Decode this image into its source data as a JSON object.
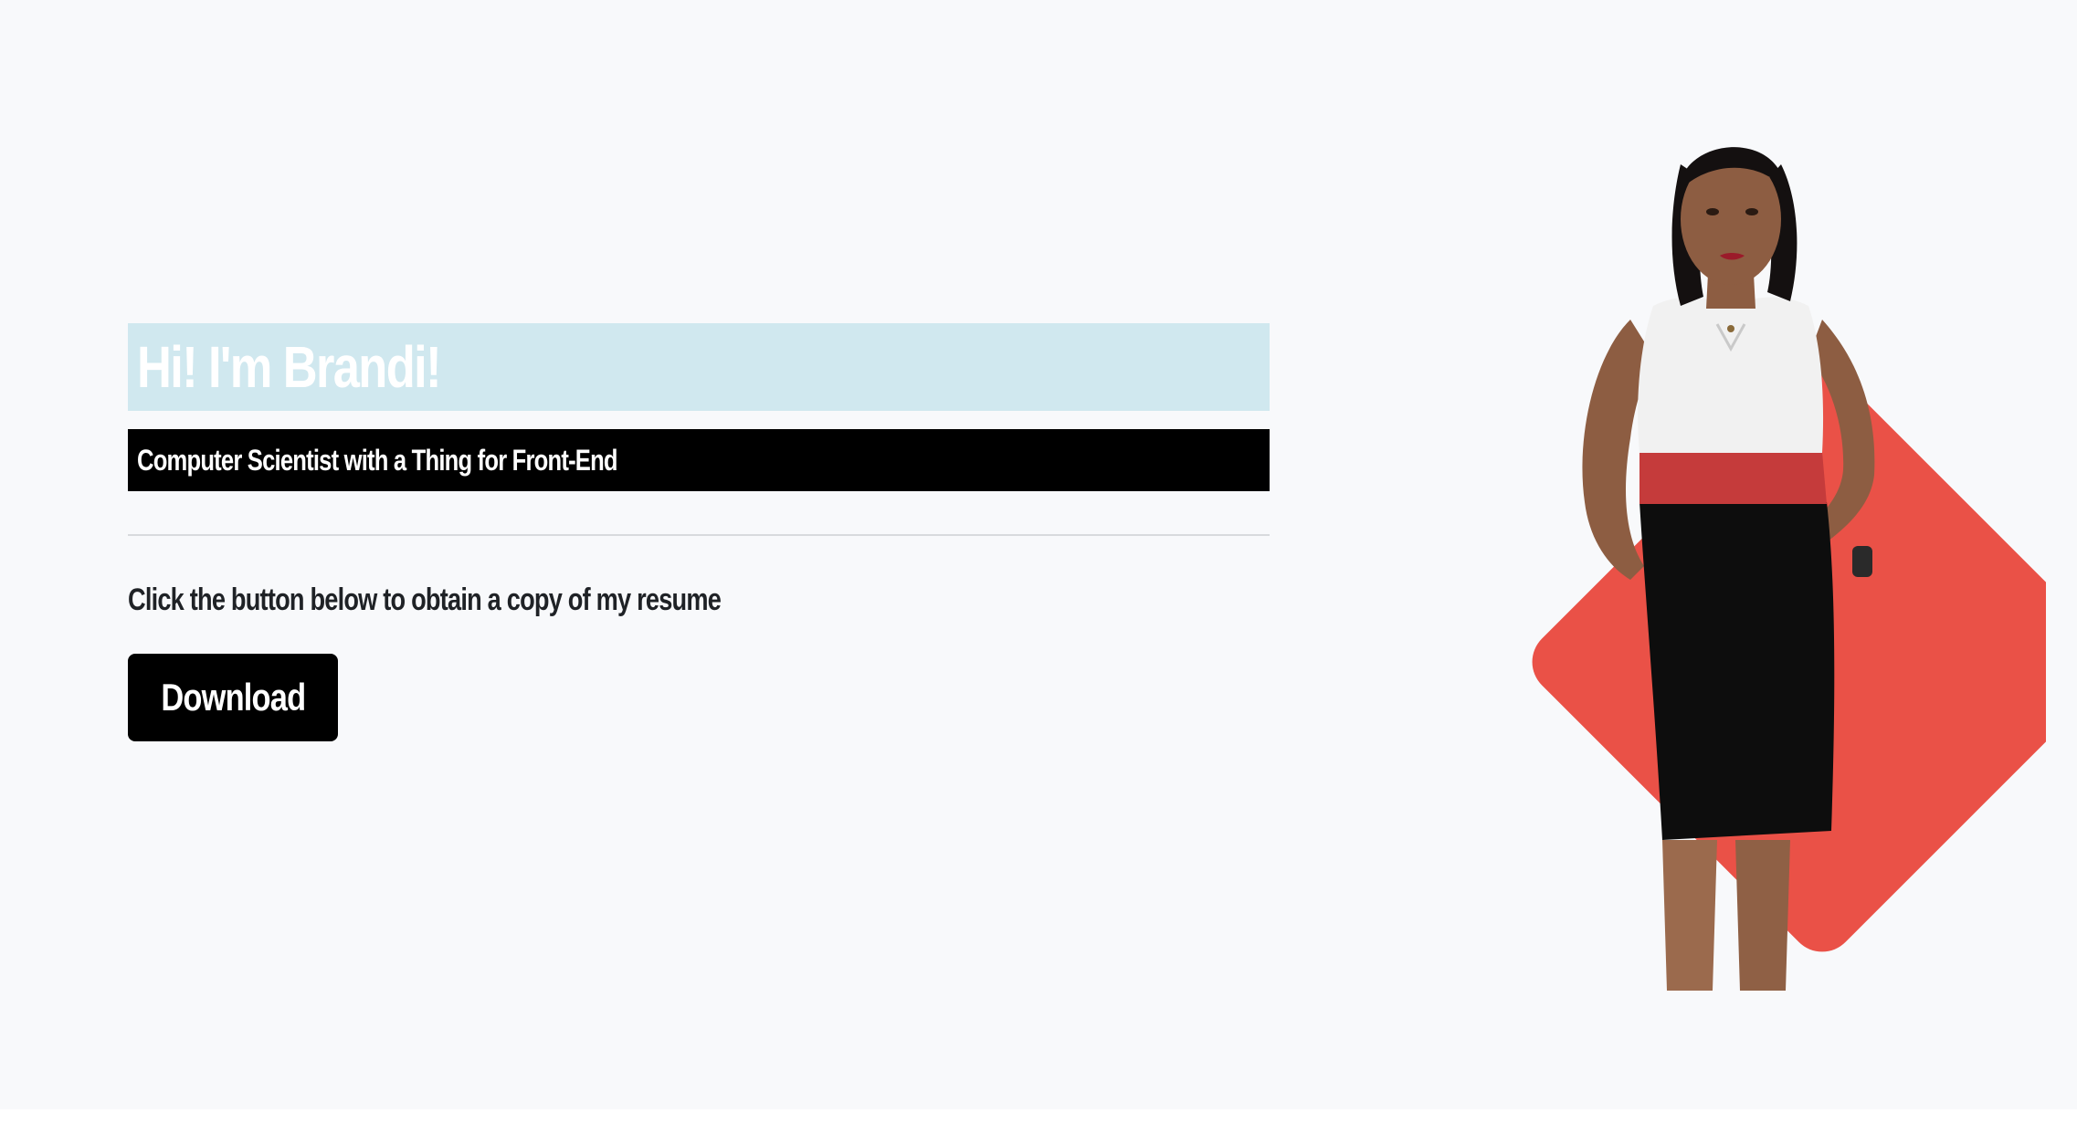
{
  "hero": {
    "heading": "Hi! I'm Brandi!",
    "subtitle": "Computer Scientist with a Thing for Front-End"
  },
  "resume": {
    "prompt": "Click the button below to obtain a copy of my resume",
    "download_label": "Download"
  },
  "portrait": {
    "alt": "Brandi"
  },
  "colors": {
    "heading_banner": "#d0e8ef",
    "subtitle_banner": "#000000",
    "button": "#000000",
    "accent_diamond": "#ea5147",
    "page_background": "#f8f9fb"
  }
}
